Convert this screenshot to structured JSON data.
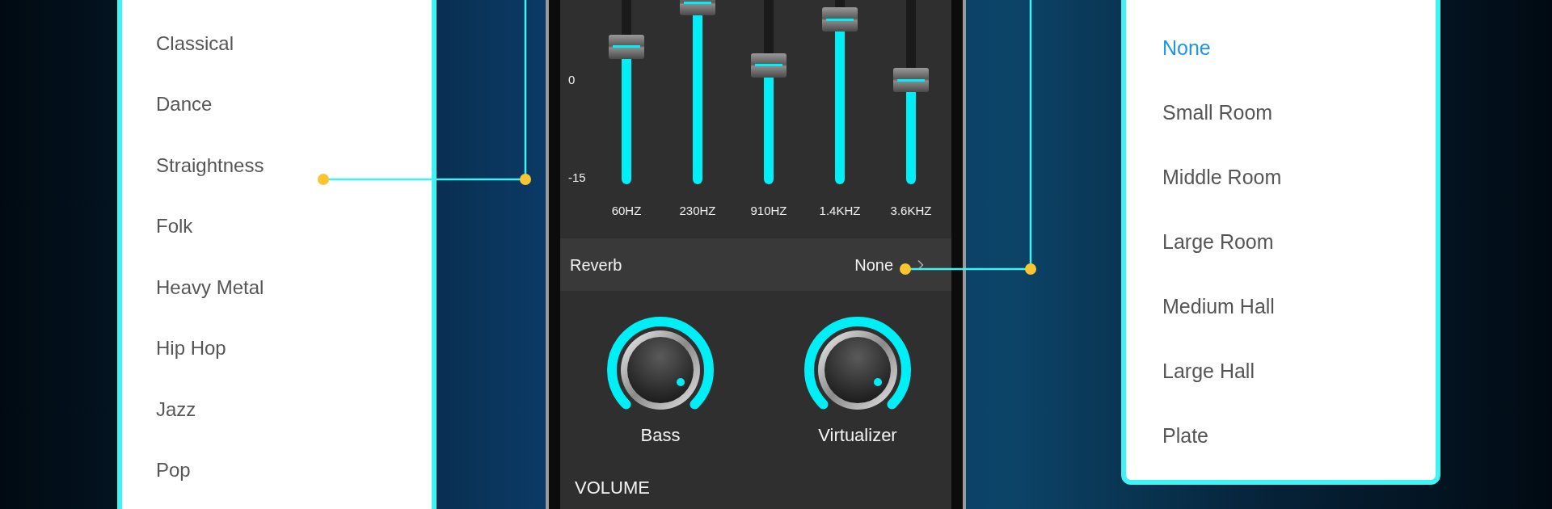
{
  "presets": [
    {
      "label": "Classical",
      "selected": false
    },
    {
      "label": "Dance",
      "selected": false
    },
    {
      "label": "Straightness",
      "selected": false
    },
    {
      "label": "Folk",
      "selected": false
    },
    {
      "label": "Heavy Metal",
      "selected": false
    },
    {
      "label": "Hip Hop",
      "selected": false
    },
    {
      "label": "Jazz",
      "selected": false
    },
    {
      "label": "Pop",
      "selected": false
    }
  ],
  "equalizer": {
    "scale": [
      "0",
      "-15"
    ],
    "bands": [
      {
        "label": "60HZ",
        "level": 0.66
      },
      {
        "label": "230HZ",
        "level": 0.87
      },
      {
        "label": "910HZ",
        "level": 0.57
      },
      {
        "label": "1.4KHZ",
        "level": 0.79
      },
      {
        "label": "3.6KHZ",
        "level": 0.5
      }
    ]
  },
  "reverb": {
    "label": "Reverb",
    "value": "None"
  },
  "knobs": [
    {
      "label": "Bass"
    },
    {
      "label": "Virtualizer"
    }
  ],
  "volume": {
    "title": "VOLUME"
  },
  "reverb_options": [
    {
      "label": "None",
      "selected": true
    },
    {
      "label": "Small Room",
      "selected": false
    },
    {
      "label": "Middle Room",
      "selected": false
    },
    {
      "label": "Large Room",
      "selected": false
    },
    {
      "label": "Medium Hall",
      "selected": false
    },
    {
      "label": "Large Hall",
      "selected": false
    },
    {
      "label": "Plate",
      "selected": false
    }
  ]
}
